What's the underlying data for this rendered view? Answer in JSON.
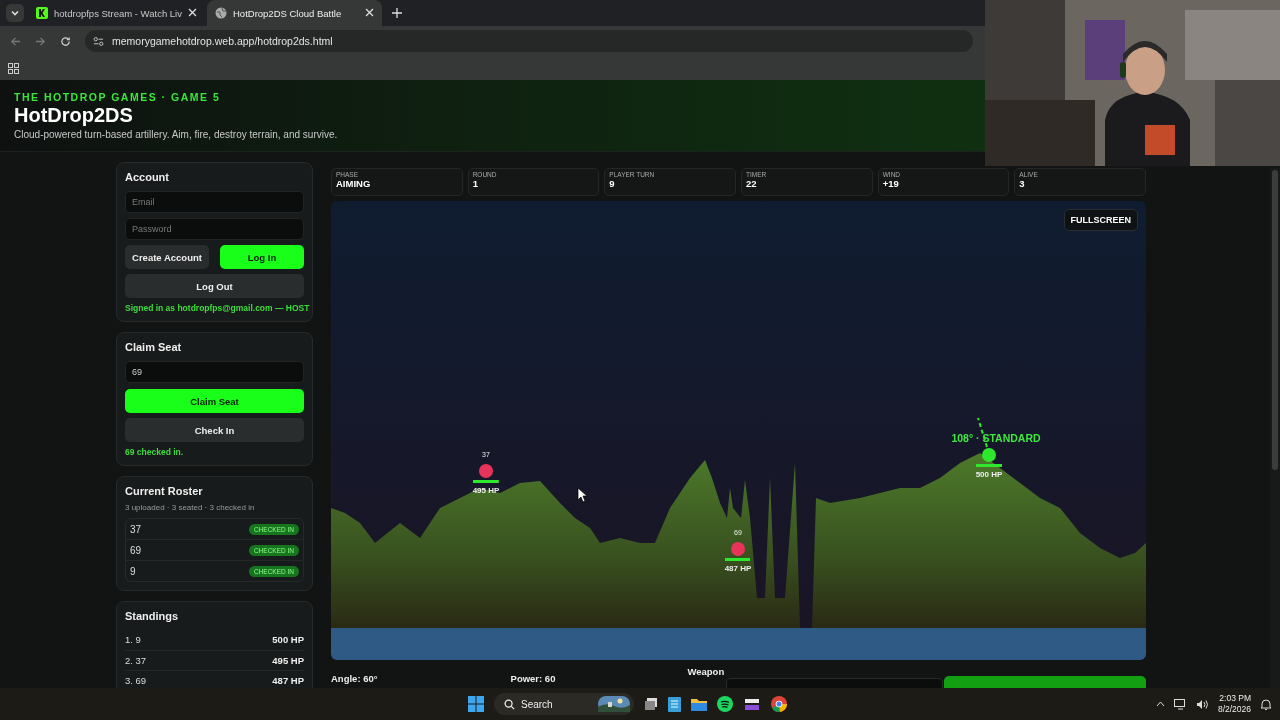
{
  "browser": {
    "tabs": [
      {
        "title": "hotdropfps Stream - Watch Liv",
        "selected": false
      },
      {
        "title": "HotDrop2DS Cloud Battle",
        "selected": true
      }
    ],
    "url": "memorygamehotdrop.web.app/hotdrop2ds.html"
  },
  "header": {
    "eyebrow": "THE HOTDROP GAMES · GAME 5",
    "title": "HotDrop2DS",
    "subtitle": "Cloud-powered turn-based artillery. Aim, fire, destroy terrain, and survive."
  },
  "account": {
    "title": "Account",
    "email_placeholder": "Email",
    "password_placeholder": "Password",
    "create_button": "Create Account",
    "login_button": "Log In",
    "logout_button": "Log Out",
    "status": "Signed in as hotdropfps@gmail.com — HOST"
  },
  "claim_seat": {
    "title": "Claim Seat",
    "seat_value": "69",
    "claim_button": "Claim Seat",
    "checkin_button": "Check In",
    "status": "69 checked in."
  },
  "roster": {
    "title": "Current Roster",
    "summary": "3 uploaded · 3 seated · 3 checked in",
    "rows": [
      {
        "name": "37",
        "status": "CHECKED IN"
      },
      {
        "name": "69",
        "status": "CHECKED IN"
      },
      {
        "name": "9",
        "status": "CHECKED IN"
      }
    ]
  },
  "standings": {
    "title": "Standings",
    "rows": [
      {
        "player": "1. 9",
        "hp": "500 HP"
      },
      {
        "player": "2. 37",
        "hp": "495 HP"
      },
      {
        "player": "3. 69",
        "hp": "487 HP"
      }
    ]
  },
  "stats": [
    {
      "label": "PHASE",
      "value": "AIMING"
    },
    {
      "label": "ROUND",
      "value": "1"
    },
    {
      "label": "PLAYER TURN",
      "value": "9"
    },
    {
      "label": "TIMER",
      "value": "22"
    },
    {
      "label": "WIND",
      "value": "+19"
    },
    {
      "label": "ALIVE",
      "value": "3"
    }
  ],
  "game": {
    "fullscreen_button": "FULLSCREEN",
    "aim_label": "108° · STANDARD",
    "players": [
      {
        "name": "37",
        "hp_label": "495 HP",
        "color": "#e8335a",
        "level": 0.99,
        "active": false
      },
      {
        "name": "69",
        "hp_label": "487 HP",
        "color": "#e8335a",
        "level": 0.97,
        "active": false
      },
      {
        "hp_label": "500 HP",
        "color": "#2ee82e",
        "level": 1,
        "active": true
      }
    ]
  },
  "controls": {
    "angle_label": "Angle: 60°",
    "power_label": "Power: 60",
    "weapon_label": "Weapon"
  },
  "taskbar": {
    "search_placeholder": "Search",
    "time": "2:03 PM",
    "date": "8/2/2026"
  }
}
